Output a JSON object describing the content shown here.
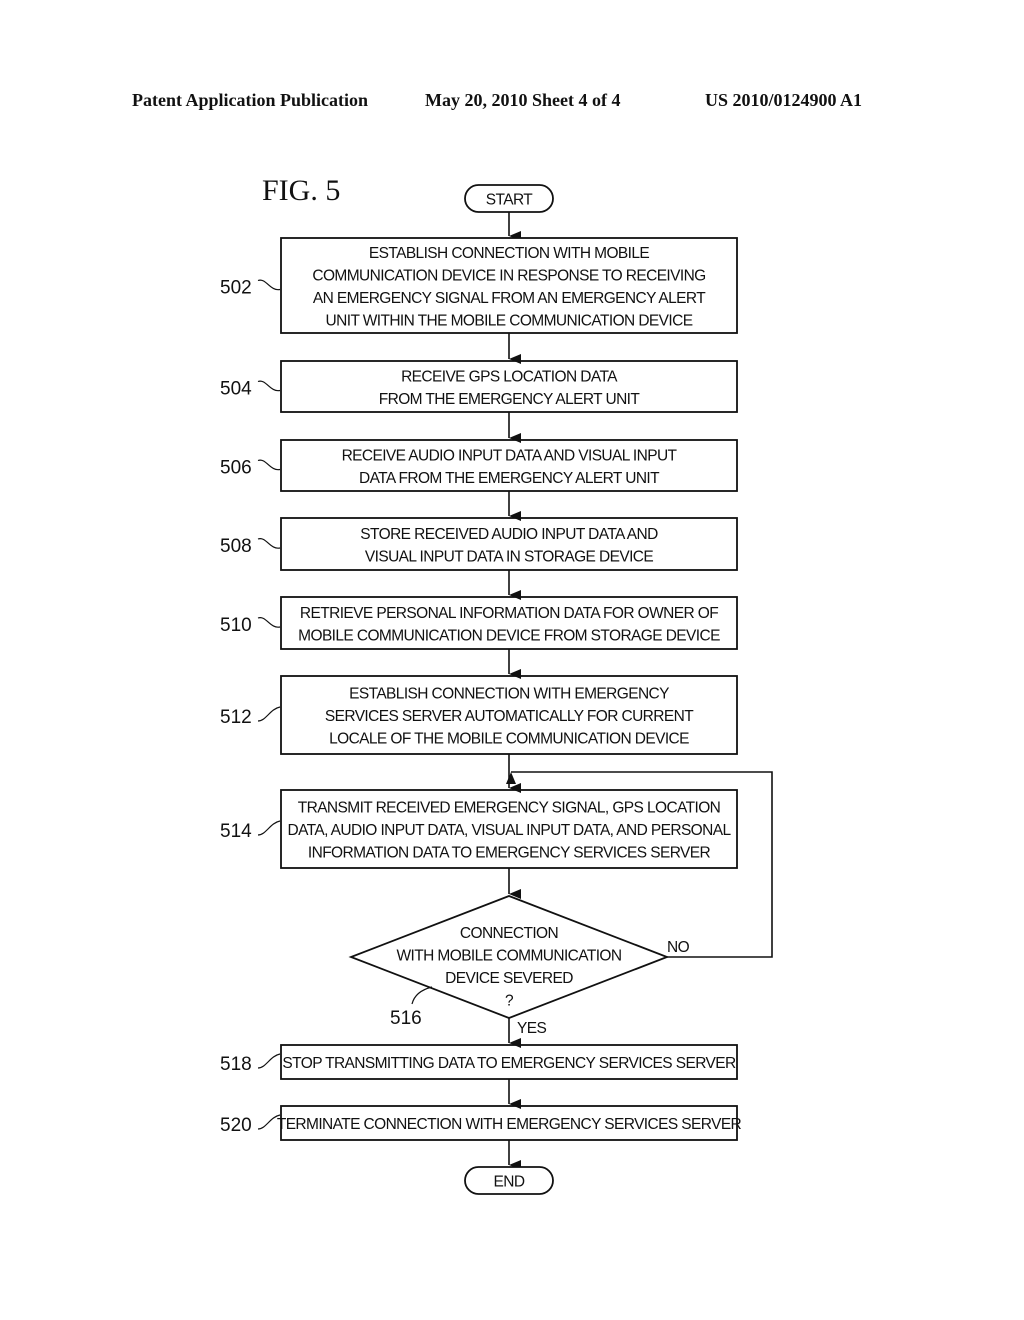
{
  "header": {
    "left": "Patent Application Publication",
    "center": "May 20, 2010  Sheet 4 of 4",
    "right": "US 2010/0124900 A1"
  },
  "figure_label": "FIG. 5",
  "terminals": {
    "start": "START",
    "end": "END"
  },
  "steps": [
    {
      "ref": "502",
      "lines": [
        "ESTABLISH CONNECTION WITH MOBILE",
        "COMMUNICATION DEVICE IN RESPONSE TO RECEIVING",
        "AN EMERGENCY SIGNAL FROM AN EMERGENCY ALERT",
        "UNIT WITHIN THE MOBILE COMMUNICATION DEVICE"
      ]
    },
    {
      "ref": "504",
      "lines": [
        "RECEIVE GPS LOCATION DATA",
        "FROM THE EMERGENCY ALERT UNIT"
      ]
    },
    {
      "ref": "506",
      "lines": [
        "RECEIVE AUDIO INPUT DATA AND VISUAL INPUT",
        "DATA FROM THE EMERGENCY ALERT UNIT"
      ]
    },
    {
      "ref": "508",
      "lines": [
        "STORE RECEIVED AUDIO INPUT DATA AND",
        "VISUAL INPUT DATA IN STORAGE DEVICE"
      ]
    },
    {
      "ref": "510",
      "lines": [
        "RETRIEVE PERSONAL INFORMATION DATA FOR OWNER OF",
        "MOBILE COMMUNICATION DEVICE FROM STORAGE DEVICE"
      ]
    },
    {
      "ref": "512",
      "lines": [
        "ESTABLISH CONNECTION WITH EMERGENCY",
        "SERVICES SERVER AUTOMATICALLY FOR CURRENT",
        "LOCALE OF THE MOBILE COMMUNICATION DEVICE"
      ]
    },
    {
      "ref": "514",
      "lines": [
        "TRANSMIT RECEIVED EMERGENCY SIGNAL, GPS LOCATION",
        "DATA, AUDIO INPUT DATA, VISUAL INPUT DATA, AND PERSONAL",
        "INFORMATION DATA TO EMERGENCY SERVICES SERVER"
      ]
    },
    {
      "ref": "518",
      "lines": [
        "STOP TRANSMITTING DATA TO EMERGENCY SERVICES SERVER"
      ]
    },
    {
      "ref": "520",
      "lines": [
        "TERMINATE CONNECTION WITH EMERGENCY SERVICES SERVER"
      ]
    }
  ],
  "decision": {
    "ref": "516",
    "lines": [
      "CONNECTION",
      "WITH MOBILE COMMUNICATION",
      "DEVICE SEVERED",
      "?"
    ],
    "yes_label": "YES",
    "no_label": "NO"
  }
}
